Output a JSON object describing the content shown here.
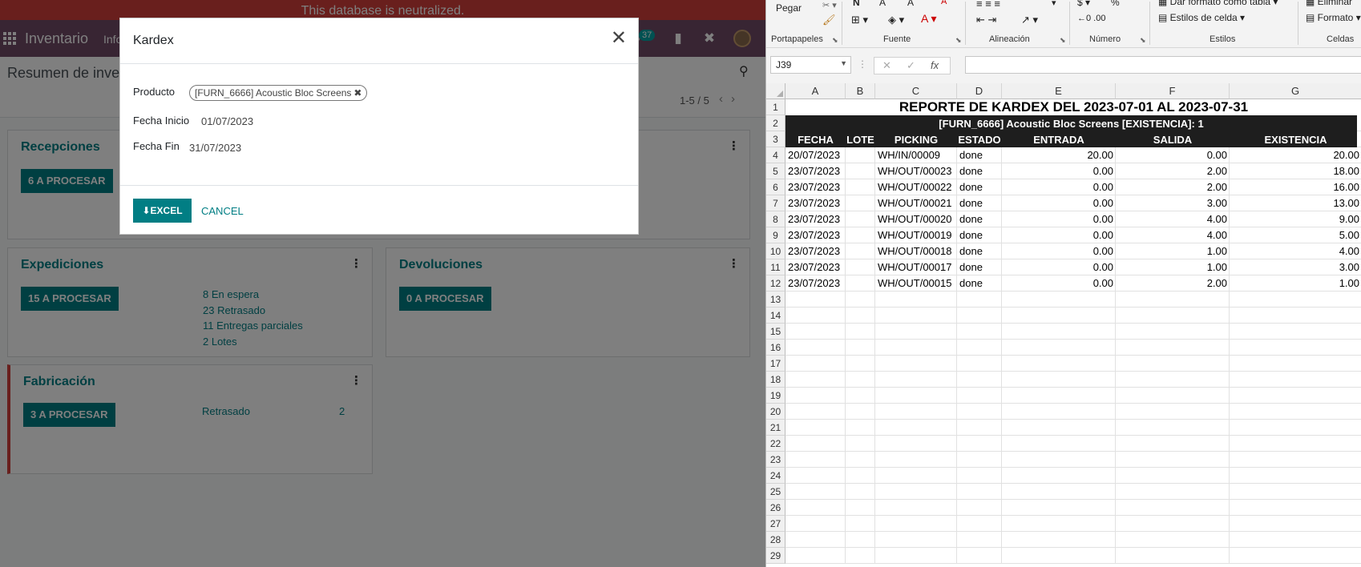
{
  "odoo": {
    "banner": "This database is neutralized.",
    "app_title": "Inventario",
    "nav_menu": "Info",
    "badge_count": "37",
    "page_title": "Resumen de inven",
    "pager": "1-5 / 5",
    "cards": [
      {
        "title": "Recepciones",
        "button": "6 A PROCESAR"
      },
      {
        "title": "Expediciones",
        "button": "15 A PROCESAR",
        "links": [
          "8 En espera",
          "23 Retrasado",
          "11 Entregas parciales",
          "2 Lotes"
        ]
      },
      {
        "title": "Devoluciones",
        "button": "0 A PROCESAR"
      },
      {
        "title": "Fabricación",
        "button": "3 A PROCESAR",
        "link_label": "Retrasado",
        "link_count": "2"
      }
    ]
  },
  "dialog": {
    "title": "Kardex",
    "product_label": "Producto",
    "product_value": "[FURN_6666] Acoustic Bloc Screens",
    "start_label": "Fecha Inicio",
    "start_value": "01/07/2023",
    "end_label": "Fecha Fin",
    "end_value": "31/07/2023",
    "excel_button": "EXCEL",
    "cancel_button": "CANCEL"
  },
  "excel": {
    "ribbon": {
      "paste": "Pegar",
      "format_table": "Dar formato como tabla",
      "cell_styles": "Estilos de celda",
      "delete": "Eliminar",
      "format": "Formato",
      "groups": [
        "Portapapeles",
        "Fuente",
        "Alineación",
        "Número",
        "Estilos",
        "Celdas"
      ]
    },
    "name_box": "J39",
    "columns": [
      "A",
      "B",
      "C",
      "D",
      "E",
      "F",
      "G"
    ],
    "report_title": "REPORTE DE KARDEX DEL 2023-07-01 AL 2023-07-31",
    "product_line": "[FURN_6666] Acoustic Bloc Screens   [EXISTENCIA]: 1",
    "headers": [
      "FECHA",
      "LOTE",
      "PICKING",
      "ESTADO",
      "ENTRADA",
      "SALIDA",
      "EXISTENCIA"
    ],
    "rows": [
      [
        "20/07/2023",
        "",
        "WH/IN/00009",
        "done",
        "20.00",
        "0.00",
        "20.00"
      ],
      [
        "23/07/2023",
        "",
        "WH/OUT/00023",
        "done",
        "0.00",
        "2.00",
        "18.00"
      ],
      [
        "23/07/2023",
        "",
        "WH/OUT/00022",
        "done",
        "0.00",
        "2.00",
        "16.00"
      ],
      [
        "23/07/2023",
        "",
        "WH/OUT/00021",
        "done",
        "0.00",
        "3.00",
        "13.00"
      ],
      [
        "23/07/2023",
        "",
        "WH/OUT/00020",
        "done",
        "0.00",
        "4.00",
        "9.00"
      ],
      [
        "23/07/2023",
        "",
        "WH/OUT/00019",
        "done",
        "0.00",
        "4.00",
        "5.00"
      ],
      [
        "23/07/2023",
        "",
        "WH/OUT/00018",
        "done",
        "0.00",
        "1.00",
        "4.00"
      ],
      [
        "23/07/2023",
        "",
        "WH/OUT/00017",
        "done",
        "0.00",
        "1.00",
        "3.00"
      ],
      [
        "23/07/2023",
        "",
        "WH/OUT/00015",
        "done",
        "0.00",
        "2.00",
        "1.00"
      ]
    ],
    "row_numbers": [
      "1",
      "2",
      "3",
      "4",
      "5",
      "6",
      "7",
      "8",
      "9",
      "10",
      "11",
      "12",
      "13",
      "14",
      "15",
      "16",
      "17",
      "18",
      "19",
      "20",
      "21",
      "22",
      "23",
      "24",
      "25",
      "26",
      "27",
      "28",
      "29"
    ]
  }
}
